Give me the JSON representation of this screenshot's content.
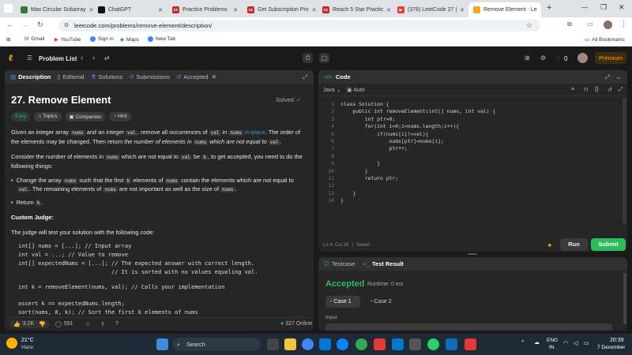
{
  "browser": {
    "tabs": [
      {
        "title": "Max Circular Subarray",
        "color": "#2e7d32"
      },
      {
        "title": "ChatGPT",
        "color": "#111111"
      },
      {
        "title": "Practice Problems",
        "color": "#c62828"
      },
      {
        "title": "Get Subscription Pro",
        "color": "#c62828"
      },
      {
        "title": "Reach 5 Star Practic",
        "color": "#c62828"
      },
      {
        "title": "(376) LeetCode 27 |",
        "color": "#e53935"
      },
      {
        "title": "Remove Element - Le",
        "color": "#f5a623"
      }
    ],
    "url": "leetcode.com/problems/remove-element/description/",
    "bookmarks": [
      "Gmail",
      "YouTube",
      "Sign in",
      "Maps",
      "New Tab"
    ],
    "all_bookmarks": "All Bookmarks"
  },
  "header": {
    "problem_list": "Problem List",
    "streak": "0",
    "premium": "Premium"
  },
  "left": {
    "tabs": [
      "Description",
      "Editorial",
      "Solutions",
      "Submissions",
      "Accepted"
    ],
    "title": "27. Remove Element",
    "status": "Solved",
    "chips": [
      "Easy",
      "Topics",
      "Companies",
      "Hint"
    ],
    "p1": [
      "Given an integer array",
      "nums",
      "and an integer",
      "val",
      ", remove all occurrences of",
      "val",
      "in",
      "nums",
      "in-place",
      ". The order of"
    ],
    "p1b": [
      "the elements may be changed. Then return",
      "the number of elements in",
      "nums",
      "which are not equal to",
      "val",
      "."
    ],
    "p2a": [
      "Consider the number of elements in",
      "nums",
      "which are not equal to",
      "val",
      "be",
      "k",
      ", to get accepted, you need to do the"
    ],
    "p2b": "following things:",
    "b1a": [
      "Change the array",
      "nums",
      "such that the first",
      "k",
      "elements of",
      "nums",
      "contain the elements which are not equal to"
    ],
    "b1b": [
      "val",
      ". The remaining elements of",
      "nums",
      "are not important as well as the size of",
      "nums",
      "."
    ],
    "b2": [
      "Return",
      "k",
      "."
    ],
    "custom_judge": "Custom Judge:",
    "judge_text": "The judge will test your solution with the following code:",
    "judge_code": [
      "int[] nums = [...]; // Input array",
      "int val = ...; // Value to remove",
      "int[] expectedNums = [...]; // The expected answer with correct length.",
      "                            // It is sorted with no values equaling val.",
      "",
      "int k = removeElement(nums, val); // Calls your implementation",
      "",
      "assert k == expectedNums.length;",
      "sort(nums, 0, k); // Sort the first k elements of nums"
    ],
    "likes": "3.2K",
    "comments": "591",
    "online": "327 Online"
  },
  "editor": {
    "title": "Code",
    "lang": "Java",
    "auto": "Auto",
    "lines": [
      "class Solution {",
      "    public int removeElement(int[] nums, int val) {",
      "        int ptr=0;",
      "        for(int i=0;i<nums.length;i++){",
      "            if(nums[i]!=val){",
      "                nums[ptr]=nums[i];",
      "                ptr++;",
      "",
      "            }",
      "        }",
      "        return ptr;",
      "",
      "    }",
      "}"
    ],
    "status": "Ln 4, Col 28",
    "saved": "Saved",
    "run": "Run",
    "submit": "Submit"
  },
  "test": {
    "tabs": [
      "Testcase",
      "Test Result"
    ],
    "result": "Accepted",
    "runtime": "Runtime: 0 ms",
    "cases": [
      "Case 1",
      "Case 2"
    ],
    "input_label": "Input"
  },
  "taskbar": {
    "temp": "21°C",
    "weather": "Haze",
    "search": "Search",
    "lang": "ENG",
    "region": "IN",
    "time": "20:39",
    "date": "7 December"
  }
}
